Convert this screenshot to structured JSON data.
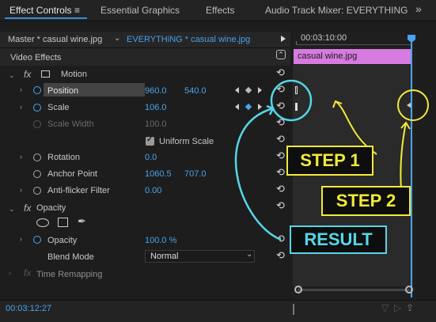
{
  "tabs": [
    "Effect Controls",
    "Essential Graphics",
    "Effects",
    "Audio Track Mixer: EVERYTHING"
  ],
  "tab_overflow": "»",
  "source": {
    "master": "Master * casual wine.jpg",
    "sequence": "EVERYTHiNG * casual wine.jpg"
  },
  "timecode_top": "00:03:10:00",
  "clip_name": "casual wine.jpg",
  "section": "Video Effects",
  "motion": {
    "label": "Motion",
    "position": {
      "label": "Position",
      "x": "960.0",
      "y": "540.0"
    },
    "scale": {
      "label": "Scale",
      "value": "106.0"
    },
    "scale_width": {
      "label": "Scale Width",
      "value": "100.0"
    },
    "uniform_scale": {
      "label": "Uniform Scale",
      "checked": true
    },
    "rotation": {
      "label": "Rotation",
      "value": "0.0"
    },
    "anchor_point": {
      "label": "Anchor Point",
      "x": "1060.5",
      "y": "707.0"
    },
    "anti_flicker": {
      "label": "Anti-flicker Filter",
      "value": "0.00"
    }
  },
  "opacity": {
    "label": "Opacity",
    "value_label": "Opacity",
    "value": "100.0 %",
    "blend_label": "Blend Mode",
    "blend_value": "Normal"
  },
  "time_remapping": "Time Remapping",
  "timecode_bottom": "00:03:12:27",
  "annotations": {
    "step1": "STEP 1",
    "step2": "STEP 2",
    "result": "RESULT"
  },
  "colors": {
    "accent": "#48a0e8",
    "annotation_yellow": "#f2ea3a",
    "annotation_cyan": "#55d6e8",
    "clip": "#d77be0"
  }
}
